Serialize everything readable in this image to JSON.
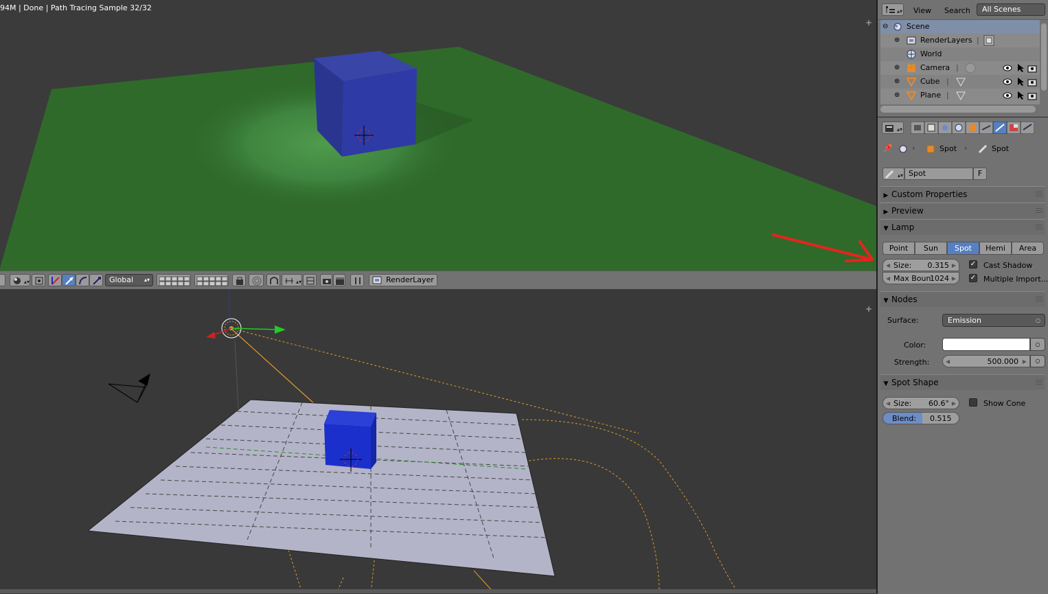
{
  "render": {
    "status": "94M | Done | Path Tracing Sample 32/32"
  },
  "header": {
    "orientation": "Global",
    "render_layer": "RenderLayer"
  },
  "outliner": {
    "menu_view": "View",
    "menu_search": "Search",
    "scene_select": "All Scenes",
    "items": [
      {
        "label": "Scene",
        "icon": "scene-icon"
      },
      {
        "label": "RenderLayers",
        "icon": "renderlayers-icon"
      },
      {
        "label": "World",
        "icon": "world-icon"
      },
      {
        "label": "Camera",
        "icon": "camera-icon"
      },
      {
        "label": "Cube",
        "icon": "mesh-icon"
      },
      {
        "label": "Plane",
        "icon": "mesh-icon"
      }
    ]
  },
  "properties": {
    "breadcrumb_object": "Spot",
    "breadcrumb_data": "Spot",
    "datablock_name": "Spot",
    "datablock_fake": "F",
    "panels": {
      "custom_properties": "Custom Properties",
      "preview": "Preview",
      "lamp": "Lamp",
      "nodes": "Nodes",
      "spot_shape": "Spot Shape"
    },
    "lamp_types": [
      "Point",
      "Sun",
      "Spot",
      "Hemi",
      "Area"
    ],
    "lamp_type_active": "Spot",
    "lamp": {
      "size_label": "Size:",
      "size_value": "0.315",
      "max_bounce_label": "Max Boun:",
      "max_bounce_value": "1024",
      "cast_shadow": "Cast Shadow",
      "multiple_importance": "Multiple Import..."
    },
    "nodes": {
      "surface_label": "Surface:",
      "surface_value": "Emission",
      "color_label": "Color:",
      "color_value": "#ffffff",
      "strength_label": "Strength:",
      "strength_value": "500.000"
    },
    "spot_shape": {
      "size_label": "Size:",
      "size_value": "60.6°",
      "show_cone": "Show Cone",
      "blend_label": "Blend:",
      "blend_value": "0.515"
    }
  },
  "colors": {
    "accent": "#5680c2",
    "annotation_arrow": "#e8231e",
    "cube": "#1f2fbf",
    "plane_render": "#2f6a2a"
  }
}
